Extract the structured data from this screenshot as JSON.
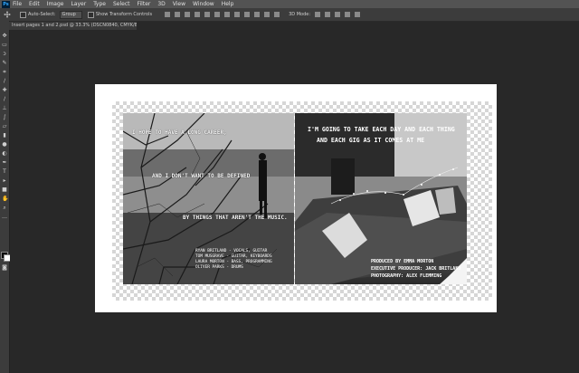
{
  "menubar": {
    "logo": "Ps",
    "items": [
      "File",
      "Edit",
      "Image",
      "Layer",
      "Type",
      "Select",
      "Filter",
      "3D",
      "View",
      "Window",
      "Help"
    ]
  },
  "options_bar": {
    "auto_select_label": "Auto-Select:",
    "auto_select_value": "Group",
    "show_transform_label": "Show Transform Controls",
    "mode_3d_label": "3D Mode:"
  },
  "document_tab": {
    "title": "Insert pages 1 and 2.psd @ 33.3% (DSCN0840, CMYK/8*) *"
  },
  "artwork": {
    "left_page": {
      "lines": [
        "I HOPE TO HAVE A LONG CAREER,",
        "AND I DON'T WANT TO BE DEFINED",
        "BY THINGS THAT AREN'T THE MUSIC."
      ],
      "credits": [
        "RYAN BRITLAND - VOCALS, GUITAR",
        "TOM MUSGRAVE - GUITAR, KEYBOARDS",
        "LAURA MORTON - BASS, PROGRAMMING",
        "OLIVER PARKS - DRUMS"
      ]
    },
    "right_page": {
      "headline": [
        "I'M GOING TO TAKE EACH DAY AND EACH THING",
        "AND EACH GIG AS IT COMES AT ME"
      ],
      "credits": [
        "PRODUCED BY EMMA MORTON",
        "EXECUTIVE PRODUCER: JACK BRITLAND",
        "PHOTOGRAPHY: ALEX FLEMMING"
      ]
    }
  }
}
